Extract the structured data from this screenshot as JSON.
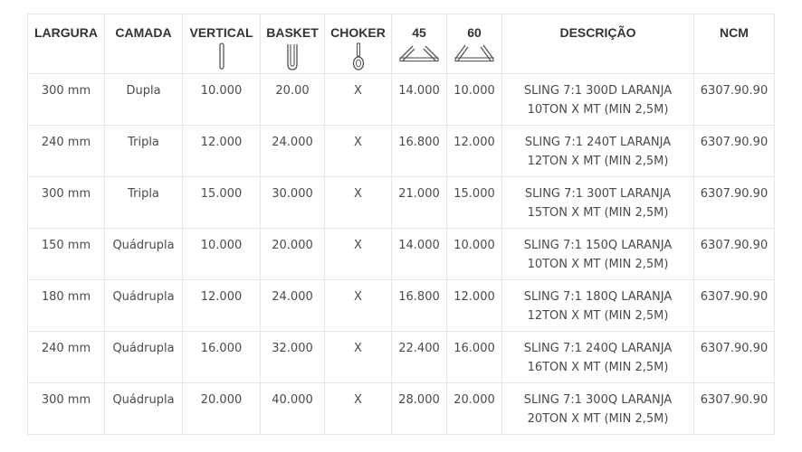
{
  "table": {
    "headers": [
      {
        "label": "LARGURA",
        "icon": ""
      },
      {
        "label": "CAMADA",
        "icon": ""
      },
      {
        "label": "VERTICAL",
        "icon": "vertical-sling-icon"
      },
      {
        "label": "BASKET",
        "icon": "basket-sling-icon"
      },
      {
        "label": "CHOKER",
        "icon": "choker-sling-icon"
      },
      {
        "label": "45",
        "icon": "angle-45-sling-icon"
      },
      {
        "label": "60",
        "icon": "angle-60-sling-icon"
      },
      {
        "label": "DESCRIÇÃO",
        "icon": ""
      },
      {
        "label": "NCM",
        "icon": ""
      }
    ],
    "rows": [
      {
        "largura": "300 mm",
        "camada": "Dupla",
        "vertical": "10.000",
        "basket": "20.00",
        "choker": "X",
        "a45": "14.000",
        "a60": "10.000",
        "desc1": "SLING 7:1 300D LARANJA",
        "desc2": "10TON X MT (MIN 2,5M)",
        "ncm": "6307.90.90"
      },
      {
        "largura": "240 mm",
        "camada": "Tripla",
        "vertical": "12.000",
        "basket": "24.000",
        "choker": "X",
        "a45": "16.800",
        "a60": "12.000",
        "desc1": "SLING 7:1 240T LARANJA",
        "desc2": "12TON X MT (MIN 2,5M)",
        "ncm": "6307.90.90"
      },
      {
        "largura": "300 mm",
        "camada": "Tripla",
        "vertical": "15.000",
        "basket": "30.000",
        "choker": "X",
        "a45": "21.000",
        "a60": "15.000",
        "desc1": "SLING 7:1 300T LARANJA",
        "desc2": "15TON X MT (MIN 2,5M)",
        "ncm": "6307.90.90"
      },
      {
        "largura": "150 mm",
        "camada": "Quádrupla",
        "vertical": "10.000",
        "basket": "20.000",
        "choker": "X",
        "a45": "14.000",
        "a60": "10.000",
        "desc1": "SLING 7:1 150Q LARANJA",
        "desc2": "10TON X MT (MIN 2,5M)",
        "ncm": "6307.90.90"
      },
      {
        "largura": "180 mm",
        "camada": "Quádrupla",
        "vertical": "12.000",
        "basket": "24.000",
        "choker": "X",
        "a45": "16.800",
        "a60": "12.000",
        "desc1": "SLING 7:1 180Q LARANJA",
        "desc2": "12TON X MT (MIN 2,5M)",
        "ncm": "6307.90.90"
      },
      {
        "largura": "240 mm",
        "camada": "Quádrupla",
        "vertical": "16.000",
        "basket": "32.000",
        "choker": "X",
        "a45": "22.400",
        "a60": "16.000",
        "desc1": "SLING 7:1 240Q LARANJA",
        "desc2": "16TON X MT (MIN 2,5M)",
        "ncm": "6307.90.90"
      },
      {
        "largura": "300 mm",
        "camada": "Quádrupla",
        "vertical": "20.000",
        "basket": "40.000",
        "choker": "X",
        "a45": "28.000",
        "a60": "20.000",
        "desc1": "SLING 7:1 300Q LARANJA",
        "desc2": "20TON X MT (MIN 2,5M)",
        "ncm": "6307.90.90"
      }
    ]
  }
}
